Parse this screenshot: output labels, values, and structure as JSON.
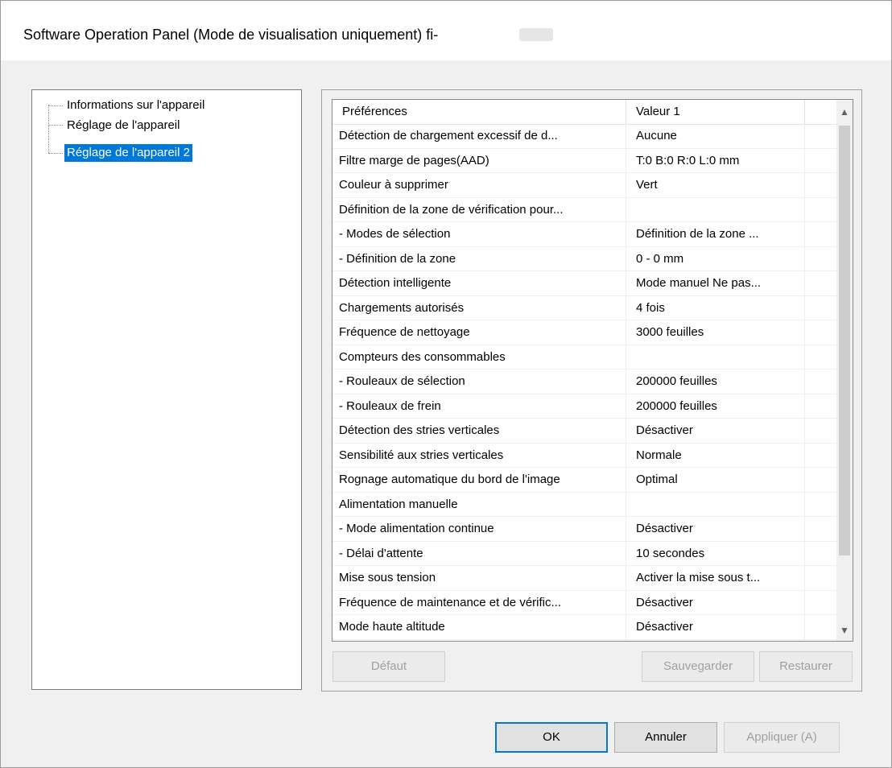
{
  "window": {
    "title": "Software Operation Panel (Mode de visualisation uniquement) fi-"
  },
  "tree": {
    "items": [
      {
        "label": "Informations sur l'appareil",
        "selected": false
      },
      {
        "label": "Réglage de l'appareil",
        "selected": false
      },
      {
        "label": "Réglage de l'appareil 2",
        "selected": true
      }
    ]
  },
  "list": {
    "columns": [
      "Préférences",
      "Valeur 1",
      ""
    ],
    "rows": [
      {
        "pref": "Détection de chargement excessif de d...",
        "value": "Aucune"
      },
      {
        "pref": "Filtre marge de pages(AAD)",
        "value": "T:0  B:0  R:0  L:0 mm"
      },
      {
        "pref": "Couleur à supprimer",
        "value": "Vert"
      },
      {
        "pref": "Définition de la zone de vérification pour...",
        "value": ""
      },
      {
        "pref": " - Modes de sélection",
        "value": "Définition de la zone ..."
      },
      {
        "pref": " - Définition de la zone",
        "value": "0 - 0 mm"
      },
      {
        "pref": "Détection intelligente",
        "value": "Mode manuel  Ne pas..."
      },
      {
        "pref": "Chargements autorisés",
        "value": "4 fois"
      },
      {
        "pref": "Fréquence de nettoyage",
        "value": "3000 feuilles"
      },
      {
        "pref": "Compteurs des consommables",
        "value": ""
      },
      {
        "pref": " - Rouleaux de sélection",
        "value": "200000 feuilles"
      },
      {
        "pref": " - Rouleaux de frein",
        "value": "200000 feuilles"
      },
      {
        "pref": "Détection des stries verticales",
        "value": "Désactiver"
      },
      {
        "pref": "Sensibilité aux stries verticales",
        "value": "Normale"
      },
      {
        "pref": "Rognage automatique du bord de l'image",
        "value": "Optimal"
      },
      {
        "pref": "Alimentation manuelle",
        "value": ""
      },
      {
        "pref": " - Mode alimentation continue",
        "value": "Désactiver"
      },
      {
        "pref": " - Délai d'attente",
        "value": "10 secondes"
      },
      {
        "pref": "Mise sous tension",
        "value": "Activer la mise sous t..."
      },
      {
        "pref": "Fréquence de maintenance et de vérific...",
        "value": "Désactiver"
      },
      {
        "pref": "Mode haute altitude",
        "value": "Désactiver"
      }
    ],
    "scroll_up_icon": "▲",
    "scroll_down_icon": "▼"
  },
  "buttons": {
    "default": "Défaut",
    "save": "Sauvegarder",
    "restore": "Restaurer",
    "ok": "OK",
    "cancel": "Annuler",
    "apply": "Appliquer (A)"
  },
  "colors": {
    "selection": "#0078d7",
    "dialog_bg": "#f0f0f0"
  }
}
